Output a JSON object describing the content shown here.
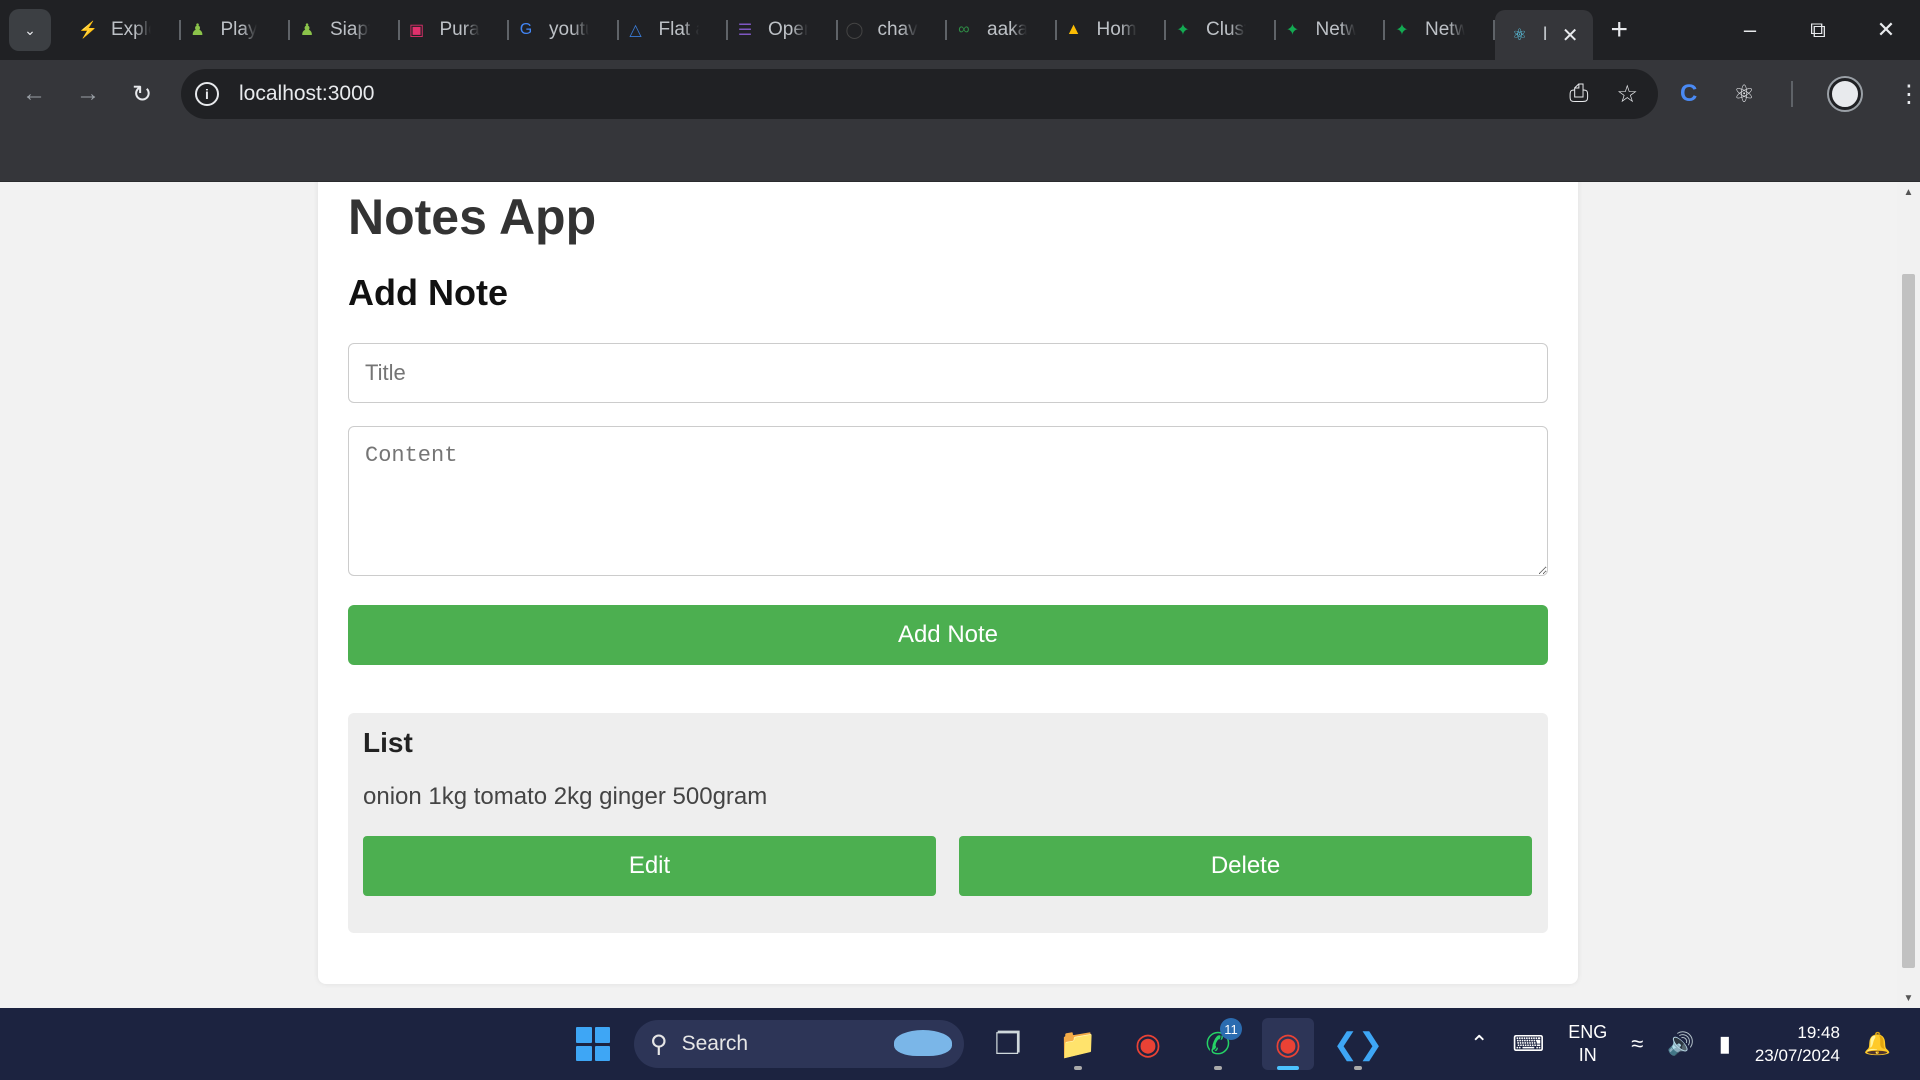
{
  "browser": {
    "tabs": [
      {
        "label": "Explo",
        "icon": "codeforces-icon"
      },
      {
        "label": "Play",
        "icon": "chess-icon"
      },
      {
        "label": "Siapt",
        "icon": "chess-icon"
      },
      {
        "label": "Pura",
        "icon": "instagram-icon"
      },
      {
        "label": "youtu",
        "icon": "google-icon"
      },
      {
        "label": "Flat a",
        "icon": "flat-icon"
      },
      {
        "label": "Oper",
        "icon": "list-icon"
      },
      {
        "label": "chavl",
        "icon": "github-icon"
      },
      {
        "label": "aaka",
        "icon": "geeksforgeeks-icon"
      },
      {
        "label": "Hom",
        "icon": "google-drive-icon"
      },
      {
        "label": "Clust",
        "icon": "mongodb-icon"
      },
      {
        "label": "Netw",
        "icon": "mongodb-icon"
      },
      {
        "label": "Netw",
        "icon": "mongodb-icon"
      }
    ],
    "active_tab": {
      "label": "I",
      "icon": "react-icon"
    },
    "url": "localhost:3000"
  },
  "app": {
    "title": "Notes App",
    "form": {
      "heading": "Add Note",
      "title_placeholder": "Title",
      "title_value": "",
      "content_placeholder": "Content",
      "content_value": "",
      "submit_label": "Add Note"
    },
    "list": {
      "heading": "List",
      "notes": [
        {
          "content": "onion 1kg tomato 2kg ginger 500gram",
          "edit_label": "Edit",
          "delete_label": "Delete"
        }
      ]
    },
    "colors": {
      "button": "#4caf50",
      "list_bg": "#eeeeee"
    }
  },
  "taskbar": {
    "search_label": "Search",
    "whatsapp_badge": "11",
    "language": "ENG",
    "region": "IN",
    "time": "19:48",
    "date": "23/07/2024"
  }
}
